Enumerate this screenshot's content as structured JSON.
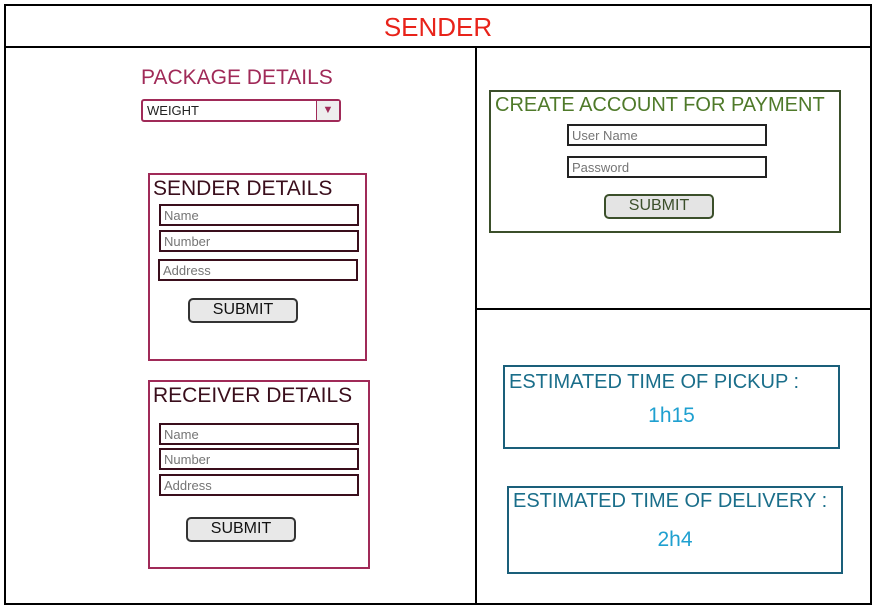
{
  "title": "SENDER",
  "package": {
    "title": "PACKAGE DETAILS",
    "weight_selected": "WEIGHT"
  },
  "sender_details": {
    "title": "SENDER DETAILS",
    "name_placeholder": "Name",
    "number_placeholder": "Number",
    "address_placeholder": "Address",
    "submit_label": "SUBMIT"
  },
  "receiver_details": {
    "title": "RECEIVER DETAILS",
    "name_placeholder": "Name",
    "number_placeholder": "Number",
    "address_placeholder": "Address",
    "submit_label": "SUBMIT"
  },
  "account": {
    "title": "CREATE ACCOUNT FOR PAYMENT",
    "username_placeholder": "User Name",
    "password_placeholder": "Password",
    "submit_label": "SUBMIT"
  },
  "estimates": {
    "pickup_label": "ESTIMATED TIME OF PICKUP :",
    "pickup_value": "1h15",
    "delivery_label": "ESTIMATED TIME OF DELIVERY :",
    "delivery_value": "2h4"
  },
  "colors": {
    "title": "#e8231a",
    "maroon": "#a02a58",
    "green": "#4f7a2a",
    "teal": "#1a6e8a",
    "value_blue": "#1fa0d0"
  },
  "icons": {
    "dropdown": "chevron-down-icon"
  }
}
